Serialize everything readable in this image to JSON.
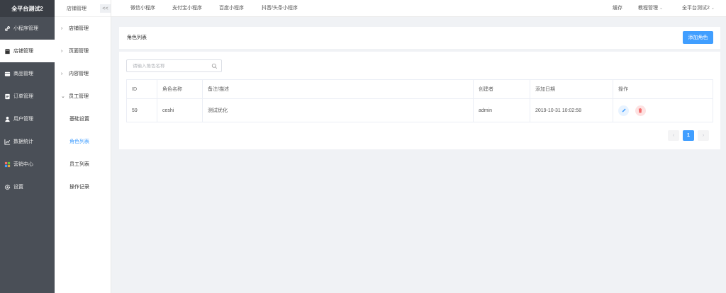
{
  "sidebar": {
    "title": "全平台测试2",
    "items": [
      {
        "label": "小程序管理",
        "icon": "link-icon"
      },
      {
        "label": "店铺管理",
        "icon": "store-icon"
      },
      {
        "label": "商品管理",
        "icon": "goods-icon"
      },
      {
        "label": "订单管理",
        "icon": "order-icon"
      },
      {
        "label": "用户管理",
        "icon": "user-icon"
      },
      {
        "label": "数据统计",
        "icon": "chart-icon"
      },
      {
        "label": "营销中心",
        "icon": "marketing-icon"
      },
      {
        "label": "设置",
        "icon": "gear-icon"
      }
    ]
  },
  "subnav": {
    "title": "店铺管理",
    "collapse": "<<",
    "groups": [
      "店铺管理",
      "页面管理",
      "内容管理",
      "员工管理"
    ],
    "leaves": [
      "基础设置",
      "角色列表",
      "员工列表",
      "操作记录"
    ]
  },
  "topbar": {
    "tabs": [
      "微信小程序",
      "支付宝小程序",
      "百度小程序",
      "抖音/头条小程序"
    ],
    "cache": "缓存",
    "tutorial": "教程管理",
    "account": "全平台测试2"
  },
  "page": {
    "title": "角色列表",
    "add_button": "添加角色",
    "search_placeholder": "请输入角色名称"
  },
  "table": {
    "headers": [
      "ID",
      "角色名称",
      "备注/描述",
      "创建者",
      "添加日期",
      "操作"
    ],
    "rows": [
      {
        "id": "59",
        "name": "ceshi",
        "note": "测试优化",
        "creator": "admin",
        "date": "2019-10-31 10:02:58"
      }
    ]
  },
  "pagination": {
    "prev": "‹",
    "current": "1",
    "next": "›"
  },
  "colors": {
    "accent": "#409eff",
    "sidebar": "#4a4f57",
    "danger": "#f56c6c"
  }
}
